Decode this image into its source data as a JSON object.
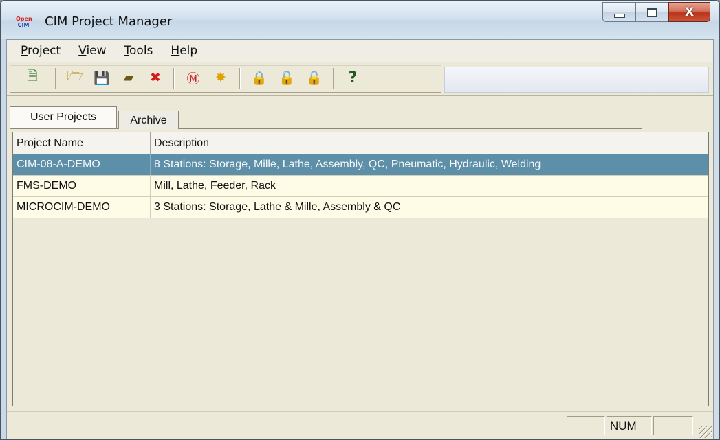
{
  "window": {
    "title": "CIM Project Manager",
    "app_icon_text": [
      "Open",
      "CIM"
    ],
    "caption": {
      "minimize": "—",
      "maximize": "□",
      "close": "X"
    }
  },
  "menu": [
    "Project",
    "View",
    "Tools",
    "Help"
  ],
  "toolbar": [
    {
      "icon": "new-project-icon",
      "glyph": "🗎",
      "color": "#2e7d2e",
      "enabled": true
    },
    {
      "icon": "open-folder-icon",
      "glyph": "🗁",
      "color": "#b38600",
      "enabled": true
    },
    {
      "icon": "save-icon",
      "glyph": "💾",
      "color": "#111111",
      "enabled": true
    },
    {
      "icon": "folder-icon",
      "glyph": "▰",
      "color": "#6b5a16",
      "enabled": true
    },
    {
      "icon": "delete-icon",
      "glyph": "✖",
      "color": "#d41c1c",
      "enabled": true
    },
    {
      "icon": "monitor-icon",
      "glyph": "Ⓜ",
      "color": "#c81e1e",
      "enabled": true
    },
    {
      "icon": "burst-icon",
      "glyph": "✸",
      "color": "#e0a000",
      "enabled": true
    },
    {
      "icon": "lock-icon",
      "glyph": "🔒",
      "color": "#333333",
      "enabled": true
    },
    {
      "icon": "unlock-icon",
      "glyph": "🔓",
      "color": "#b4b0a0",
      "enabled": false
    },
    {
      "icon": "folder-lock-icon",
      "glyph": "🔓",
      "color": "#b4b0a0",
      "enabled": false
    },
    {
      "icon": "help-icon",
      "glyph": "?",
      "color": "#1f5a1f",
      "enabled": true
    }
  ],
  "tabs": [
    {
      "label": "User Projects",
      "active": true
    },
    {
      "label": "Archive",
      "active": false
    }
  ],
  "grid": {
    "columns": [
      "Project Name",
      "Description"
    ],
    "rows": [
      {
        "name": "CIM-08-A-DEMO",
        "description": "8 Stations: Storage, Mille, Lathe, Assembly, QC, Pneumatic, Hydraulic, Welding",
        "selected": true
      },
      {
        "name": "FMS-DEMO",
        "description": "Mill, Lathe, Feeder, Rack",
        "selected": false
      },
      {
        "name": "MICROCIM-DEMO",
        "description": "3 Stations: Storage, Lathe & Mille, Assembly & QC",
        "selected": false
      }
    ]
  },
  "status": {
    "num_indicator": "NUM"
  }
}
